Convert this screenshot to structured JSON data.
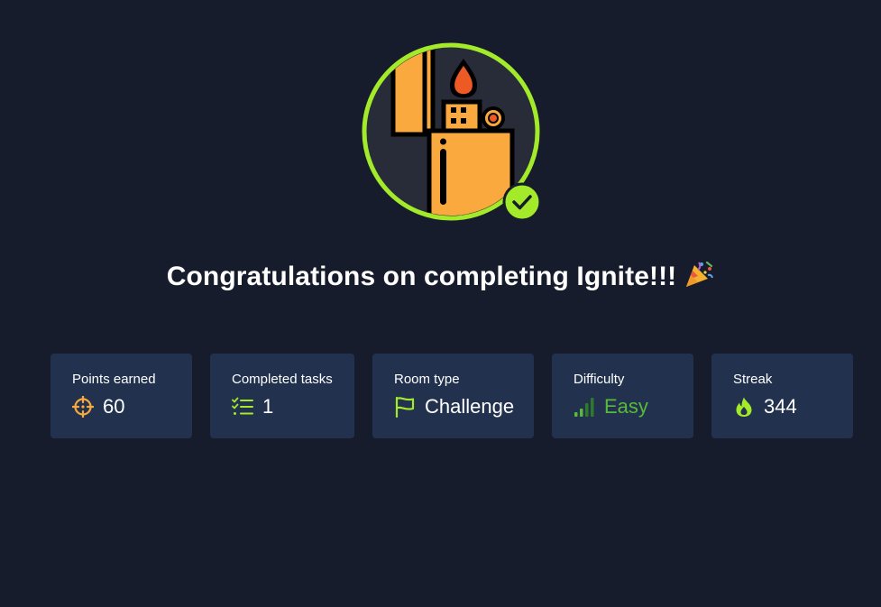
{
  "room": {
    "name": "Ignite",
    "completion_title": "Congratulations on completing Ignite!!!",
    "celebration_emoji": "🎉"
  },
  "stats": {
    "points": {
      "label": "Points earned",
      "value": "60",
      "icon": "crosshair-icon"
    },
    "tasks": {
      "label": "Completed tasks",
      "value": "1",
      "icon": "checklist-icon"
    },
    "room_type": {
      "label": "Room type",
      "value": "Challenge",
      "icon": "flag-icon"
    },
    "difficulty": {
      "label": "Difficulty",
      "value": "Easy",
      "icon": "signal-bars-icon"
    },
    "streak": {
      "label": "Streak",
      "value": "344",
      "icon": "flame-icon"
    }
  },
  "colors": {
    "background": "#161c2b",
    "card": "#22324e",
    "badge_ring": "#a3ea2a",
    "lighter_body": "#f9a93d",
    "flame": "#ee5a24",
    "easy": "#58b93b",
    "points_icon": "#f9a93d",
    "accent_green": "#a3ea2a"
  }
}
